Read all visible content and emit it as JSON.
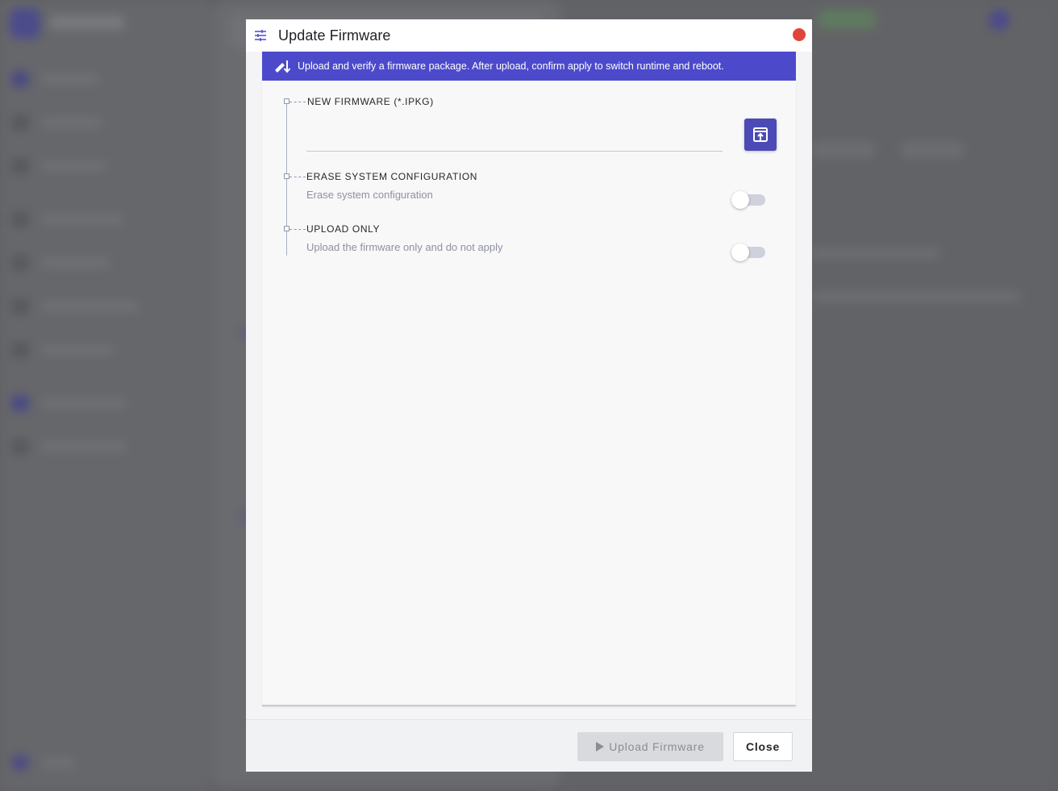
{
  "modal": {
    "title": "Update Firmware",
    "banner_text": "Upload and verify a firmware package. After upload, confirm apply to switch runtime and reboot.",
    "fields": {
      "new_firmware": {
        "label": "NEW FIRMWARE (*.IPKG)",
        "value": ""
      },
      "erase_config": {
        "label": "ERASE SYSTEM CONFIGURATION",
        "description": "Erase system configuration",
        "enabled": false
      },
      "upload_only": {
        "label": "UPLOAD ONLY",
        "description": "Upload the firmware only and do not apply",
        "enabled": false
      }
    },
    "footer": {
      "upload_label": "Upload Firmware",
      "close_label": "Close"
    }
  },
  "colors": {
    "accent": "#4c4acb",
    "close_dot": "#e0453c",
    "overlay": "#5f6063"
  },
  "icons": {
    "header": "sliders-icon",
    "banner": "firmware-download-icon",
    "browse": "file-upload-icon",
    "upload": "play-icon",
    "close": "close-dot-icon"
  }
}
